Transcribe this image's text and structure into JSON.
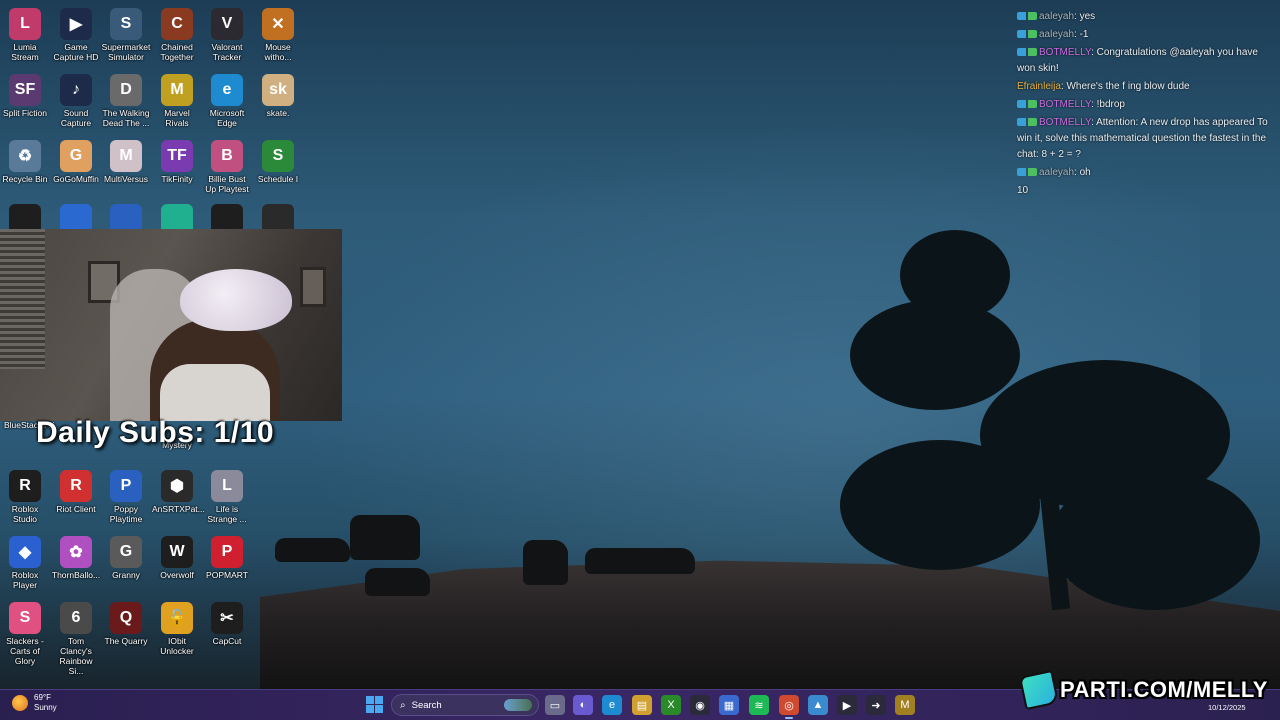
{
  "desktop_icons": [
    {
      "label": "Lumia Stream",
      "icon": "lumia-stream-icon",
      "color": "#c03a6a",
      "glyph": "L"
    },
    {
      "label": "Game Capture HD",
      "icon": "game-capture-icon",
      "color": "#1e2a4a",
      "glyph": "▶"
    },
    {
      "label": "Supermarket Simulator",
      "icon": "supermarket-simulator-icon",
      "color": "#3a5a7a",
      "glyph": "S"
    },
    {
      "label": "Chained Together",
      "icon": "chained-together-icon",
      "color": "#8a3a20",
      "glyph": "C"
    },
    {
      "label": "Valorant Tracker",
      "icon": "valorant-tracker-icon",
      "color": "#2a2a30",
      "glyph": "V"
    },
    {
      "label": "Mouse witho...",
      "icon": "mouse-without-borders-icon",
      "color": "#c07020",
      "glyph": "✕"
    },
    {
      "label": "Split Fiction",
      "icon": "split-fiction-icon",
      "color": "#5a3a70",
      "glyph": "SF"
    },
    {
      "label": "Sound Capture",
      "icon": "sound-capture-icon",
      "color": "#1e2a4a",
      "glyph": "♪"
    },
    {
      "label": "The Walking Dead The ...",
      "icon": "walking-dead-icon",
      "color": "#6a6a6a",
      "glyph": "D"
    },
    {
      "label": "Marvel Rivals",
      "icon": "marvel-rivals-icon",
      "color": "#c0a020",
      "glyph": "M"
    },
    {
      "label": "Microsoft Edge",
      "icon": "edge-icon",
      "color": "#1e8ad0",
      "glyph": "e"
    },
    {
      "label": "skate.",
      "icon": "skate-icon",
      "color": "#d0b080",
      "glyph": "sk"
    },
    {
      "label": "Recycle Bin",
      "icon": "recycle-bin-icon",
      "color": "#5a7a9a",
      "glyph": "♻"
    },
    {
      "label": "GoGoMuffin",
      "icon": "gogomuffin-icon",
      "color": "#e0a060",
      "glyph": "G"
    },
    {
      "label": "MultiVersus",
      "icon": "multiversus-icon",
      "color": "#d0c0c8",
      "glyph": "M"
    },
    {
      "label": "TikFinity",
      "icon": "tikfinity-icon",
      "color": "#7a3ab0",
      "glyph": "TF"
    },
    {
      "label": "Billie Bust Up Playtest",
      "icon": "billie-bust-up-icon",
      "color": "#c05080",
      "glyph": "B"
    },
    {
      "label": "Schedule I",
      "icon": "schedule-one-icon",
      "color": "#2a8a3a",
      "glyph": "S"
    },
    {
      "label": "Roblox Studio",
      "icon": "roblox-studio-icon",
      "color": "#1e1e1e",
      "glyph": "R"
    },
    {
      "label": "Riot Client",
      "icon": "riot-client-icon",
      "color": "#d03030",
      "glyph": "R"
    },
    {
      "label": "Poppy Playtime",
      "icon": "poppy-playtime-icon",
      "color": "#2a60c0",
      "glyph": "P"
    },
    {
      "label": "AnSRTXPat...",
      "icon": "ansrtx-icon",
      "color": "#2a2a2a",
      "glyph": "⬢"
    },
    {
      "label": "Life is Strange ...",
      "icon": "life-is-strange-icon",
      "color": "#8a8a9a",
      "glyph": "L"
    },
    {
      "label": "Roblox Player",
      "icon": "roblox-player-icon",
      "color": "#2a60d0",
      "glyph": "◆"
    },
    {
      "label": "ThornBallo...",
      "icon": "thornballoon-icon",
      "color": "#b050c0",
      "glyph": "✿"
    },
    {
      "label": "Granny",
      "icon": "granny-icon",
      "color": "#5a5a5a",
      "glyph": "G"
    },
    {
      "label": "Overwolf",
      "icon": "overwolf-icon",
      "color": "#1e1e1e",
      "glyph": "W"
    },
    {
      "label": "POPMART",
      "icon": "popmart-icon",
      "color": "#d02030",
      "glyph": "P"
    },
    {
      "label": "Slackers - Carts of Glory",
      "icon": "slackers-icon",
      "color": "#e05080",
      "glyph": "S"
    },
    {
      "label": "Tom Clancy's Rainbow Si...",
      "icon": "rainbow-six-icon",
      "color": "#4a4a4a",
      "glyph": "6"
    },
    {
      "label": "The Quarry",
      "icon": "the-quarry-icon",
      "color": "#6a1a1a",
      "glyph": "Q"
    },
    {
      "label": "IObit Unlocker",
      "icon": "iobit-unlocker-icon",
      "color": "#e0a020",
      "glyph": "🔓"
    },
    {
      "label": "CapCut",
      "icon": "capcut-icon",
      "color": "#1e1e1e",
      "glyph": "✂"
    }
  ],
  "partial_icons": [
    {
      "label": "BlueStacks X",
      "icon": "bluestacks-icon"
    },
    {
      "label": "Mystery",
      "icon": "mystery-icon"
    }
  ],
  "overlay": {
    "daily_subs": "Daily Subs: 1/10"
  },
  "chat": [
    {
      "user": "aaleyah",
      "user_class": "u-aal",
      "message": ": yes",
      "badges": true
    },
    {
      "user": "aaleyah",
      "user_class": "u-aal",
      "message": ": -1",
      "badges": true
    },
    {
      "user": "BOTMELLY",
      "user_class": "u-bot",
      "message": ": Congratulations @aaleyah you have won skin!",
      "badges": true
    },
    {
      "user": "Efrainleija",
      "user_class": "u-efr",
      "message": ": Where's the f ing blow dude",
      "badges": false
    },
    {
      "user": "BOTMELLY",
      "user_class": "u-bot",
      "message": ": !bdrop",
      "badges": true
    },
    {
      "user": "BOTMELLY",
      "user_class": "u-bot",
      "message": ": Attention: A new drop has appeared To win it, solve this mathematical question the fastest in the chat: 8 + 2 = ?",
      "badges": true
    },
    {
      "user": "aaleyah",
      "user_class": "u-aal",
      "message": ": oh",
      "badges": true
    },
    {
      "user": "",
      "user_class": "",
      "message": "10",
      "badges": false
    }
  ],
  "taskbar": {
    "weather_temp": "69°F",
    "weather_desc": "Sunny",
    "search_label": "Search",
    "date": "10/12/2025",
    "apps": [
      {
        "name": "task-view-icon",
        "glyph": "▭",
        "color": "#6a6a8a"
      },
      {
        "name": "copilot-icon",
        "glyph": "◐",
        "color": "#6a5ad0"
      },
      {
        "name": "edge-taskbar-icon",
        "glyph": "e",
        "color": "#1e8ad0"
      },
      {
        "name": "file-explorer-icon",
        "glyph": "▤",
        "color": "#d0a030"
      },
      {
        "name": "xbox-icon",
        "glyph": "X",
        "color": "#2a8a2a"
      },
      {
        "name": "game-capture-taskbar-icon",
        "glyph": "◉",
        "color": "#2a2a3a"
      },
      {
        "name": "microsoft-store-icon",
        "glyph": "▦",
        "color": "#3a6ad0"
      },
      {
        "name": "spotify-icon",
        "glyph": "≋",
        "color": "#1db954"
      },
      {
        "name": "chrome-icon",
        "glyph": "◎",
        "color": "#d04a30"
      },
      {
        "name": "photos-icon",
        "glyph": "▲",
        "color": "#3a8ad0"
      },
      {
        "name": "media-player-icon",
        "glyph": "▶",
        "color": "#2a2a3a"
      },
      {
        "name": "arrow-app-icon",
        "glyph": "➜",
        "color": "#2a2a3a"
      },
      {
        "name": "marvel-rivals-taskbar-icon",
        "glyph": "M",
        "color": "#a08020"
      }
    ]
  },
  "branding": {
    "parti_url": "PARTI.COM/MELLY"
  }
}
